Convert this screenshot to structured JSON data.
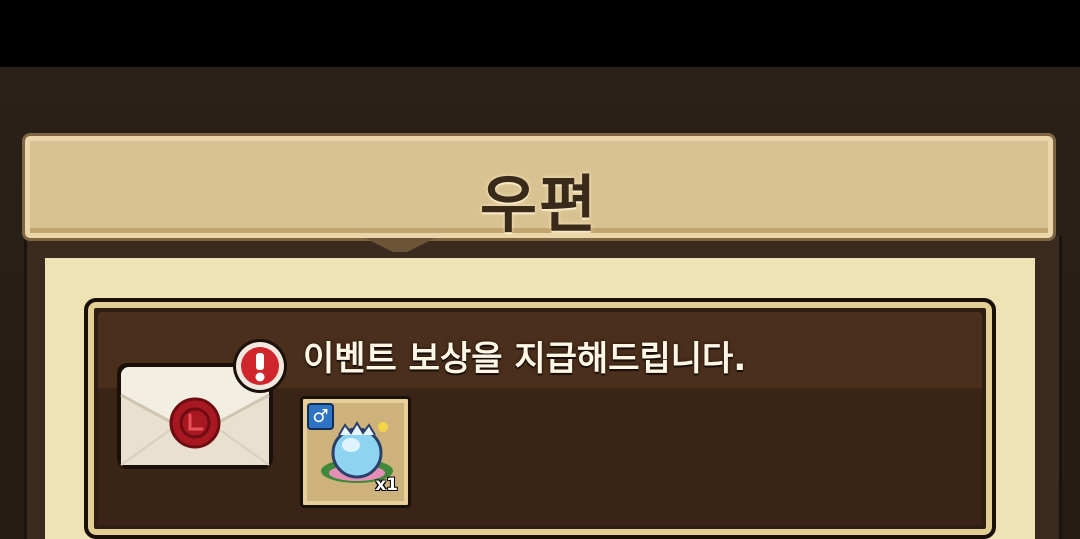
{
  "window": {
    "title": "우편"
  },
  "mail": {
    "items": [
      {
        "title": "이벤트 보상을 지급해드립니다.",
        "envelope_icon": "sealed-envelope-icon",
        "alert_icon": "exclamation-icon",
        "reward": {
          "gender_symbol": "♂",
          "item_icon": "egg-pet-icon",
          "quantity": "x1"
        }
      }
    ]
  },
  "colors": {
    "title_text": "#3a2a1a",
    "banner": "#d9c291",
    "card_bg": "#2f1f12",
    "card_border": "#e3cf93",
    "alert_red": "#d0262b",
    "gender_blue": "#2f73c4"
  }
}
